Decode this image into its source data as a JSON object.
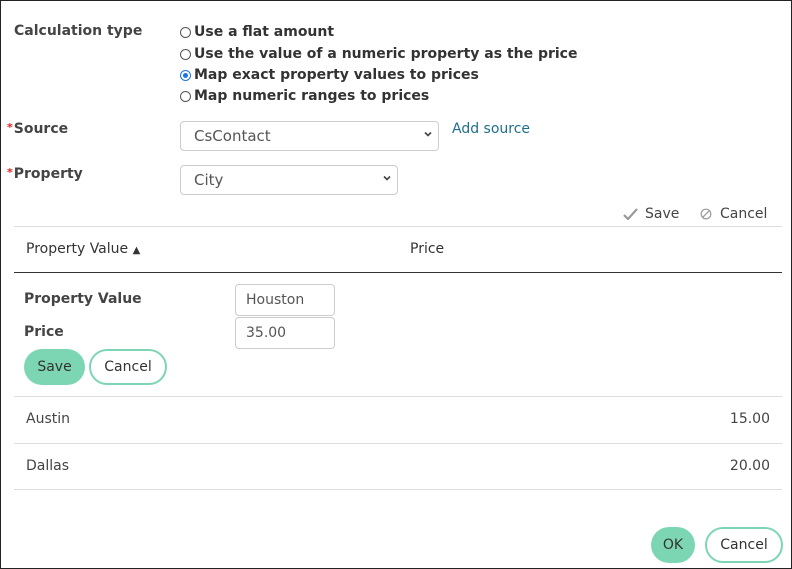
{
  "calc_type": {
    "label": "Calculation type",
    "options": [
      {
        "label": "Use a flat amount",
        "selected": false
      },
      {
        "label": "Use the value of a numeric property as the price",
        "selected": false
      },
      {
        "label": "Map exact property values to prices",
        "selected": true
      },
      {
        "label": "Map numeric ranges to prices",
        "selected": false
      }
    ]
  },
  "source": {
    "required_mark": "*",
    "label": "Source",
    "value": "CsContact",
    "add_link": "Add source"
  },
  "property": {
    "required_mark": "*",
    "label": "Property",
    "value": "City"
  },
  "table_actions": {
    "save": "Save",
    "cancel": "Cancel"
  },
  "table": {
    "headers": {
      "property_value": "Property Value",
      "sort_indicator": "▲",
      "price": "Price"
    },
    "edit_row": {
      "property_value_label": "Property Value",
      "property_value": "Houston",
      "price_label": "Price",
      "price": "35.00",
      "save": "Save",
      "cancel": "Cancel"
    },
    "rows": [
      {
        "property_value": "Austin",
        "price": "15.00"
      },
      {
        "property_value": "Dallas",
        "price": "20.00"
      }
    ]
  },
  "footer": {
    "ok": "OK",
    "cancel": "Cancel"
  }
}
